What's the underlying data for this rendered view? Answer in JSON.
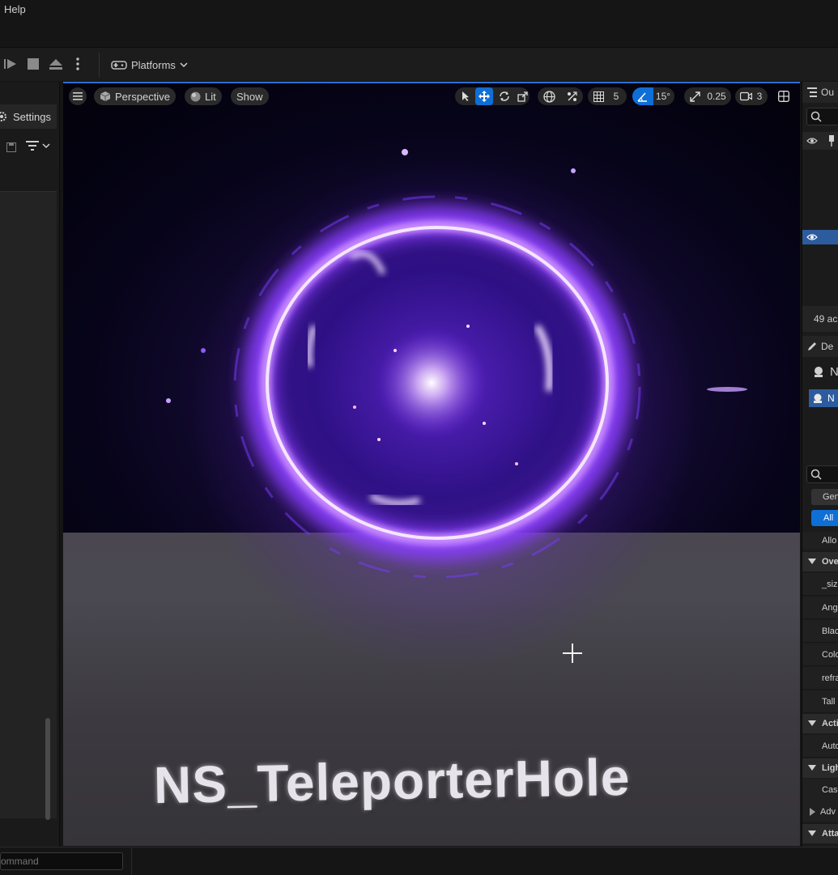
{
  "menubar": {
    "help": "Help"
  },
  "toolbar": {
    "platforms_label": "Platforms"
  },
  "left_panel": {
    "settings_label": "Settings"
  },
  "viewport": {
    "perspective_label": "Perspective",
    "lit_label": "Lit",
    "show_label": "Show",
    "grid_snap_value": "5",
    "rotation_snap_value": "15°",
    "scale_snap_value": "0.25",
    "camera_speed_value": "3",
    "overlay_label": "NS_TeleporterHole"
  },
  "right_panel": {
    "outliner_tab": "Ou",
    "actor_count": "49 ac",
    "details_tab": "De",
    "component_a": "N",
    "component_b": "N",
    "filter_general": "Gen",
    "filter_all": "All",
    "allow_row": "Allo",
    "rows": [
      {
        "type": "cat",
        "label": "Ove"
      },
      {
        "type": "prop",
        "label": "_siz"
      },
      {
        "type": "prop",
        "label": "Ang"
      },
      {
        "type": "prop",
        "label": "Blac"
      },
      {
        "type": "prop",
        "label": "Colo"
      },
      {
        "type": "prop",
        "label": "refra"
      },
      {
        "type": "prop",
        "label": "Tall"
      },
      {
        "type": "cat",
        "label": "Acti"
      },
      {
        "type": "prop",
        "label": "Auto"
      },
      {
        "type": "cat",
        "label": "Ligh"
      },
      {
        "type": "prop",
        "label": "Cas"
      },
      {
        "type": "prop",
        "label": "Adv"
      },
      {
        "type": "cat",
        "label": "Atta"
      }
    ]
  },
  "statusbar": {
    "command_placeholder": "ommand"
  },
  "colors": {
    "accent": "#0e6fd6",
    "portal": "#b66bff"
  }
}
